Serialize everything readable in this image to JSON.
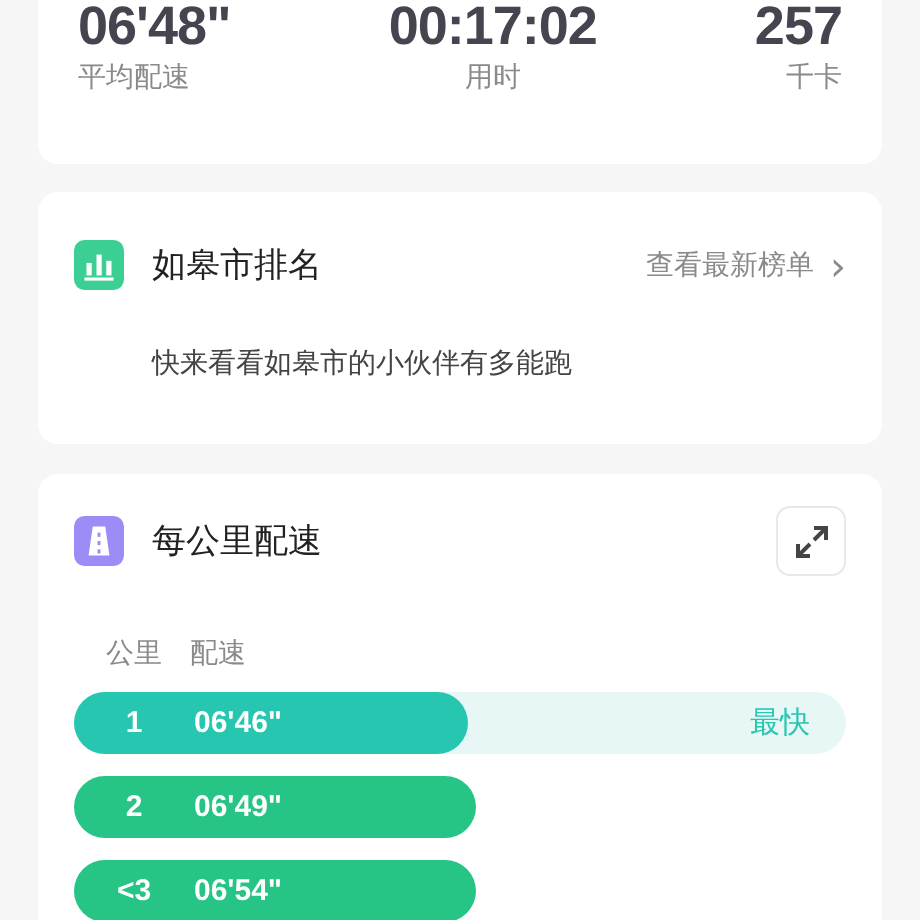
{
  "summary": {
    "stats": [
      {
        "value": "06'48\"",
        "label": "平均配速"
      },
      {
        "value": "00:17:02",
        "label": "用时"
      },
      {
        "value": "257",
        "label": "千卡"
      }
    ]
  },
  "ranking": {
    "title": "如皋市排名",
    "link": "查看最新榜单",
    "chevron": "›",
    "description": "快来看看如皋市的小伙伴有多能跑"
  },
  "pace": {
    "title": "每公里配速",
    "columns": [
      "公里",
      "配速"
    ],
    "rows": [
      {
        "km": "1",
        "pace": "06'46\"",
        "level": 0.51,
        "color": "#26c6b0",
        "tag": "最快"
      },
      {
        "km": "2",
        "pace": "06'49\"",
        "color": "#26c485"
      },
      {
        "km": "<3",
        "pace": "06'54\"",
        "color": "#26c485"
      }
    ]
  }
}
